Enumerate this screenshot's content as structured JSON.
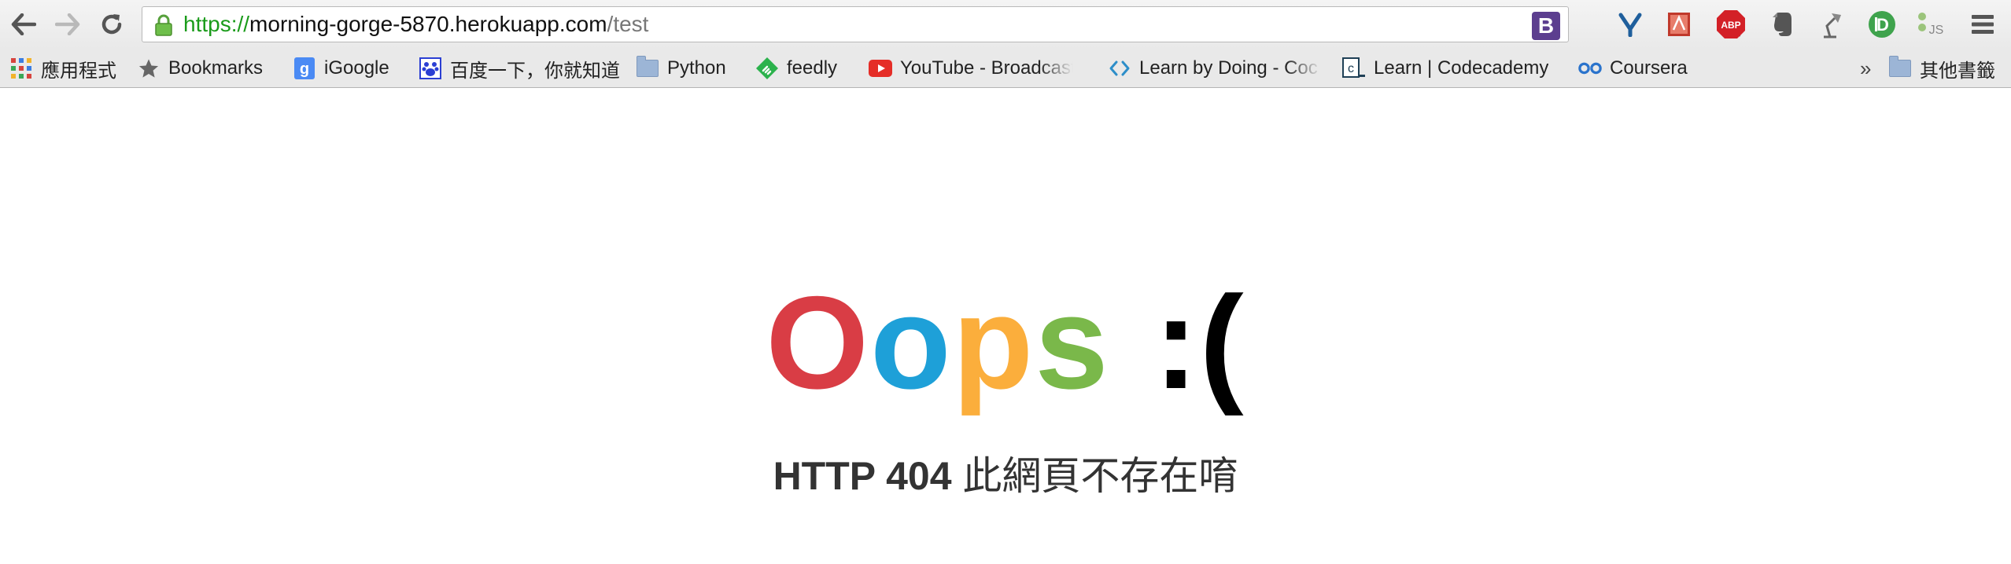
{
  "browser": {
    "omnibox": {
      "scheme": "https://",
      "host": "morning-gorge-5870.herokuapp.com",
      "path": "/test",
      "badge_letter": "B"
    },
    "extensions": [
      {
        "name": "yslow-icon"
      },
      {
        "name": "pdf-icon"
      },
      {
        "name": "adblock-icon",
        "text": "ABP"
      },
      {
        "name": "evernote-icon"
      },
      {
        "name": "lamp-icon"
      },
      {
        "name": "inbox-icon",
        "text": "D"
      },
      {
        "name": "js-icon",
        "text": "JS"
      },
      {
        "name": "menu-icon"
      }
    ]
  },
  "bookmarks": {
    "items": [
      {
        "label": "應用程式",
        "icon": "apps-icon"
      },
      {
        "label": "Bookmarks",
        "icon": "star-icon"
      },
      {
        "label": "iGoogle",
        "icon": "google-icon"
      },
      {
        "label": "百度一下，你就知道",
        "icon": "baidu-icon"
      },
      {
        "label": "Python",
        "icon": "folder-icon"
      },
      {
        "label": "feedly",
        "icon": "feedly-icon"
      },
      {
        "label": "YouTube - Broadcast",
        "icon": "youtube-icon"
      },
      {
        "label": "Learn by Doing - Coc",
        "icon": "code-icon"
      },
      {
        "label": "Learn | Codecademy",
        "icon": "codecademy-icon"
      },
      {
        "label": "Coursera",
        "icon": "coursera-icon"
      }
    ],
    "overflow": "»",
    "other_folder": "其他書籤"
  },
  "page": {
    "oops_letters": [
      {
        "char": "O",
        "color": "#d93d45"
      },
      {
        "char": "o",
        "color": "#1ea0d8"
      },
      {
        "char": "p",
        "color": "#fbae3c"
      },
      {
        "char": "s",
        "color": "#7ab84a"
      }
    ],
    "face": ":(",
    "face_color": "#000000",
    "http_code": "HTTP 404",
    "message": "此網頁不存在唷"
  }
}
